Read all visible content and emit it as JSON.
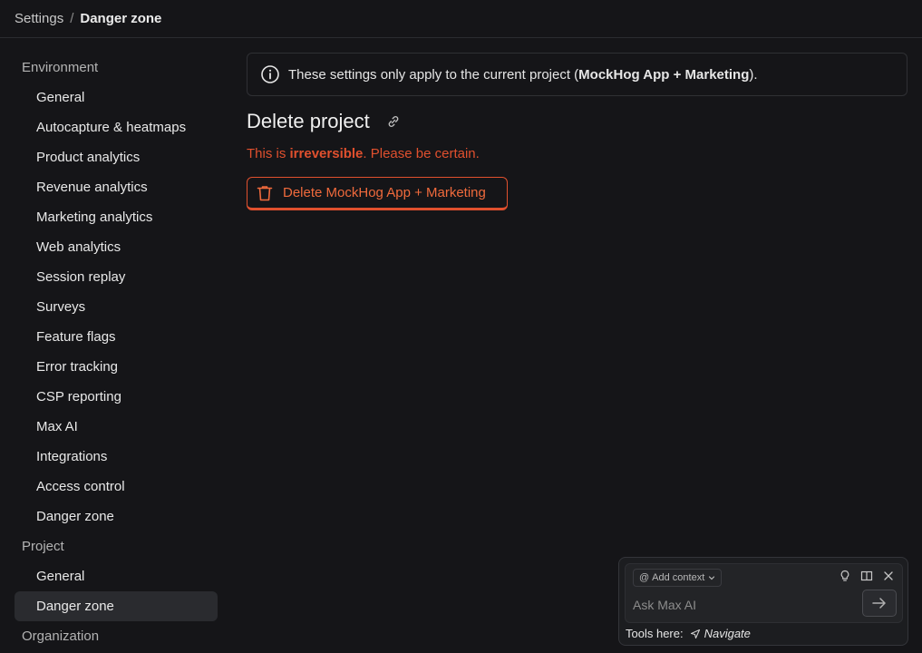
{
  "breadcrumb": {
    "parent": "Settings",
    "separator": "/",
    "current": "Danger zone"
  },
  "sidebar": {
    "sections": [
      {
        "title": "Environment",
        "items": [
          {
            "label": "General"
          },
          {
            "label": "Autocapture & heatmaps"
          },
          {
            "label": "Product analytics"
          },
          {
            "label": "Revenue analytics"
          },
          {
            "label": "Marketing analytics"
          },
          {
            "label": "Web analytics"
          },
          {
            "label": "Session replay"
          },
          {
            "label": "Surveys"
          },
          {
            "label": "Feature flags"
          },
          {
            "label": "Error tracking"
          },
          {
            "label": "CSP reporting"
          },
          {
            "label": "Max AI"
          },
          {
            "label": "Integrations"
          },
          {
            "label": "Access control"
          },
          {
            "label": "Danger zone"
          }
        ]
      },
      {
        "title": "Project",
        "items": [
          {
            "label": "General"
          },
          {
            "label": "Danger zone",
            "active": true
          }
        ]
      },
      {
        "title": "Organization",
        "items": []
      }
    ]
  },
  "main": {
    "banner": {
      "icon": "info-icon",
      "prefix": "These settings only apply to the current project (",
      "project": "MockHog App + Marketing",
      "suffix": ")."
    },
    "heading": "Delete project",
    "heading_icon": "link-icon",
    "warning": {
      "prefix": "This is ",
      "strong": "irreversible",
      "suffix": ". Please be certain."
    },
    "delete_button": {
      "icon": "trash-icon",
      "label": "Delete MockHog App + Marketing"
    }
  },
  "chat": {
    "add_context": {
      "at": "@",
      "label": "Add context"
    },
    "placeholder": "Ask Max AI",
    "tools_label": "Tools here:",
    "tool_navigate": "Navigate"
  },
  "colors": {
    "background": "#151518",
    "danger": "#e0502e",
    "danger_text": "#f06a3c",
    "active_item": "#2a2b2f"
  }
}
